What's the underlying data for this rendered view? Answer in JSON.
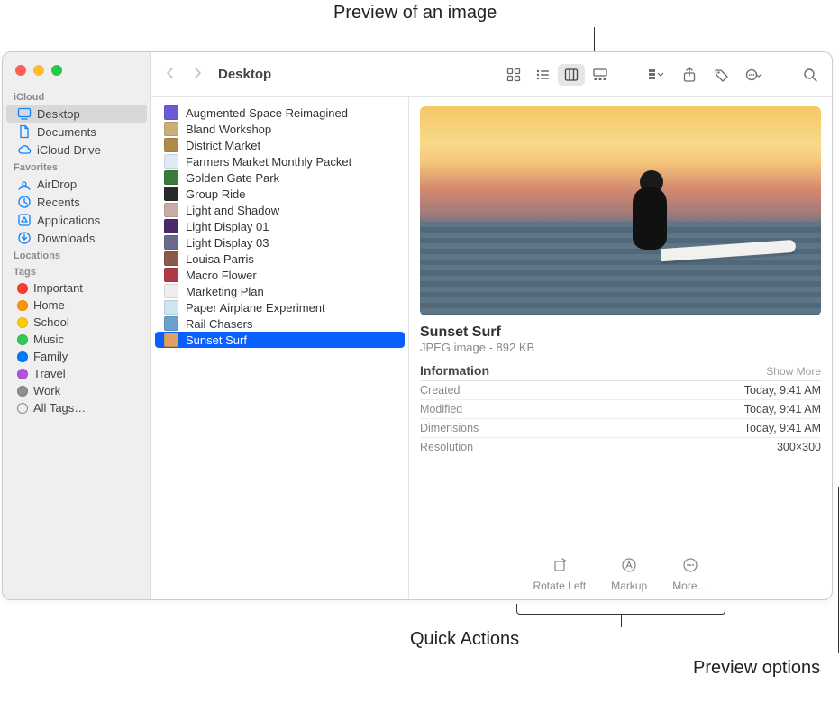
{
  "callouts": {
    "top": "Preview of an image",
    "bottom_left": "Quick Actions",
    "bottom_right": "Preview options"
  },
  "breadcrumb": "Desktop",
  "sidebar": {
    "sections": [
      {
        "heading": "iCloud",
        "items": [
          {
            "label": "Desktop",
            "active": true,
            "icon": "desktop"
          },
          {
            "label": "Documents",
            "active": false,
            "icon": "doc"
          },
          {
            "label": "iCloud Drive",
            "active": false,
            "icon": "cloud"
          }
        ]
      },
      {
        "heading": "Favorites",
        "items": [
          {
            "label": "AirDrop",
            "icon": "airdrop"
          },
          {
            "label": "Recents",
            "icon": "clock"
          },
          {
            "label": "Applications",
            "icon": "app"
          },
          {
            "label": "Downloads",
            "icon": "download"
          }
        ]
      },
      {
        "heading": "Locations",
        "items": []
      },
      {
        "heading": "Tags",
        "items": [
          {
            "label": "Important",
            "color": "#ff3b30"
          },
          {
            "label": "Home",
            "color": "#ff9500"
          },
          {
            "label": "School",
            "color": "#ffcc00"
          },
          {
            "label": "Music",
            "color": "#34c759"
          },
          {
            "label": "Family",
            "color": "#007aff"
          },
          {
            "label": "Travel",
            "color": "#af52de"
          },
          {
            "label": "Work",
            "color": "#8e8e93"
          },
          {
            "label": "All Tags…",
            "outline": true
          }
        ]
      }
    ]
  },
  "files": [
    {
      "name": "Augmented Space Reimagined",
      "thumb": "#6b5bd6"
    },
    {
      "name": "Bland Workshop",
      "thumb": "#c9b07a"
    },
    {
      "name": "District Market",
      "thumb": "#b08a4a"
    },
    {
      "name": "Farmers Market Monthly Packet",
      "thumb": "#dfeaf5"
    },
    {
      "name": "Golden Gate Park",
      "thumb": "#3a7a3a"
    },
    {
      "name": "Group Ride",
      "thumb": "#2a2a2a"
    },
    {
      "name": "Light and Shadow",
      "thumb": "#caa"
    },
    {
      "name": "Light Display 01",
      "thumb": "#4a2a6a"
    },
    {
      "name": "Light Display 03",
      "thumb": "#6a6a8a"
    },
    {
      "name": "Louisa Parris",
      "thumb": "#8a5a4a"
    },
    {
      "name": "Macro Flower",
      "thumb": "#b03a4a"
    },
    {
      "name": "Marketing Plan",
      "thumb": "#eee"
    },
    {
      "name": "Paper Airplane Experiment",
      "thumb": "#cde5f0"
    },
    {
      "name": "Rail Chasers",
      "thumb": "#6aa0d0"
    },
    {
      "name": "Sunset Surf",
      "thumb": "#e0a060",
      "selected": true
    }
  ],
  "preview": {
    "title": "Sunset Surf",
    "subtitle": "JPEG image - 892 KB",
    "info_heading": "Information",
    "show_more": "Show More",
    "rows": [
      {
        "k": "Created",
        "v": "Today, 9:41 AM"
      },
      {
        "k": "Modified",
        "v": "Today, 9:41 AM"
      },
      {
        "k": "Dimensions",
        "v": "Today, 9:41 AM"
      },
      {
        "k": "Resolution",
        "v": "300×300"
      }
    ],
    "quick_actions": [
      {
        "label": "Rotate Left",
        "icon": "rotate"
      },
      {
        "label": "Markup",
        "icon": "markup"
      },
      {
        "label": "More…",
        "icon": "more"
      }
    ]
  }
}
